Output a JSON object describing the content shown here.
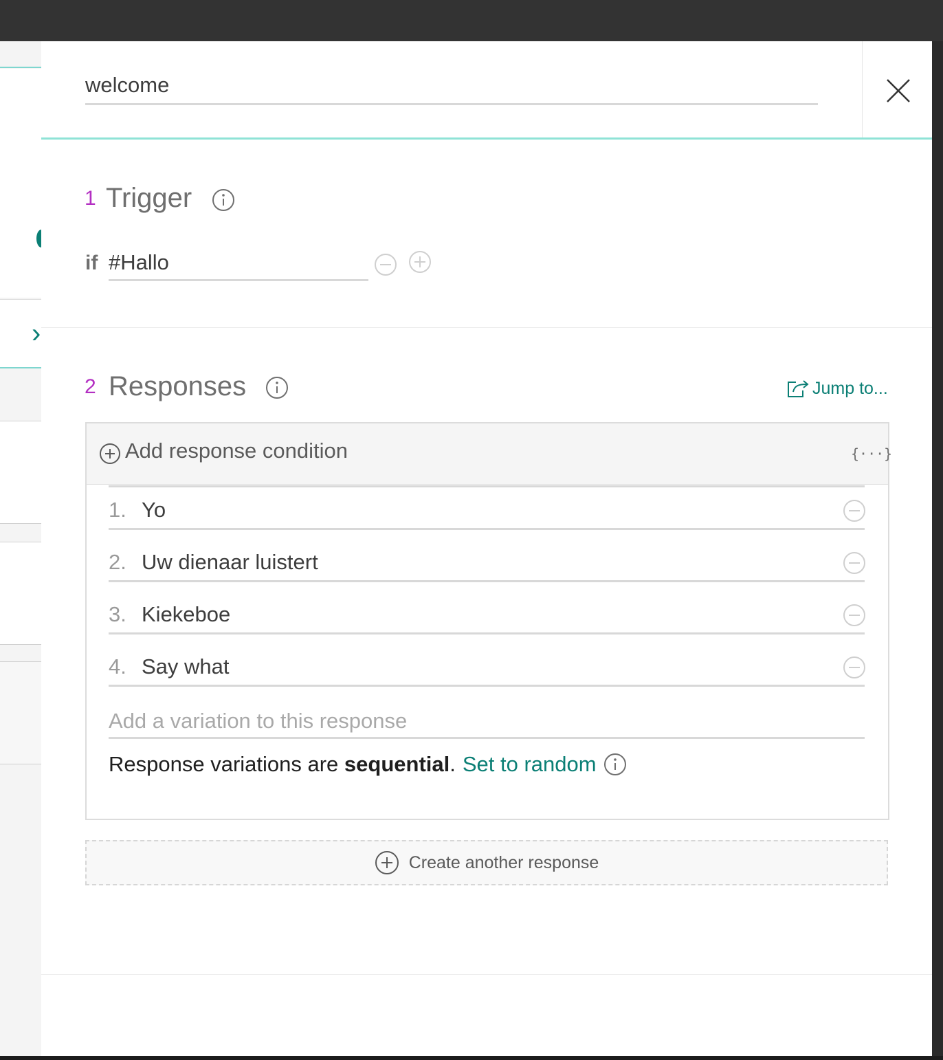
{
  "node": {
    "name": "welcome"
  },
  "trigger": {
    "number": "1",
    "title": "Trigger",
    "if_label": "if",
    "condition": "#Hallo"
  },
  "responses": {
    "number": "2",
    "title": "Responses",
    "jump_to_label": "Jump to...",
    "add_condition_label": "Add response condition",
    "context_icon_text": "{···}",
    "variations": [
      {
        "num": "1.",
        "text": "Yo"
      },
      {
        "num": "2.",
        "text": "Uw dienaar luistert"
      },
      {
        "num": "3.",
        "text": "Kiekeboe"
      },
      {
        "num": "4.",
        "text": "Say what"
      }
    ],
    "add_variation_placeholder": "Add a variation to this response",
    "mode_text": "Response variations are",
    "mode_value": "sequential",
    "mode_period": ".",
    "set_random_label": "Set to random",
    "create_another_label": "Create another response"
  },
  "colors": {
    "accent_teal": "#0b7f75",
    "header_border": "#8fe3d6",
    "section_number": "#b32fc2"
  }
}
